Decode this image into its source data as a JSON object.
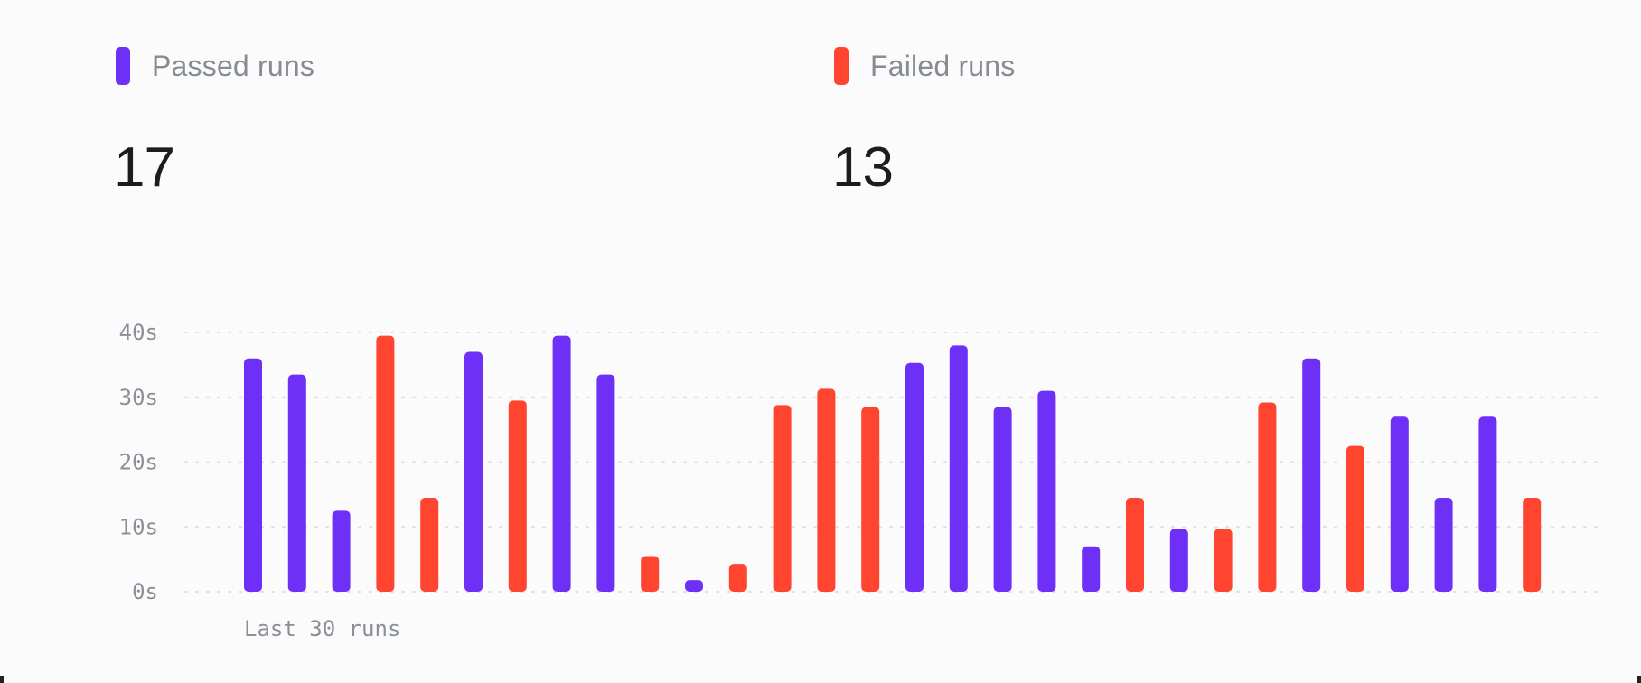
{
  "colors": {
    "passed": "#6e2ff7",
    "failed": "#ff4530",
    "grid": "#dedfe3",
    "background": "#fbfbfc"
  },
  "stats": {
    "passed": {
      "label": "Passed runs",
      "value": "17"
    },
    "failed": {
      "label": "Failed runs",
      "value": "13"
    }
  },
  "chart_data": {
    "type": "bar",
    "xlabel": "Last 30 runs",
    "ylabel": "",
    "ylim": [
      0,
      40
    ],
    "yticks": [
      {
        "value": 40,
        "label": "40s"
      },
      {
        "value": 30,
        "label": "30s"
      },
      {
        "value": 20,
        "label": "20s"
      },
      {
        "value": 10,
        "label": "10s"
      },
      {
        "value": 0,
        "label": "0s"
      }
    ],
    "grid": true,
    "legend": "top",
    "bars": [
      {
        "value": 36,
        "status": "passed"
      },
      {
        "value": 33.5,
        "status": "passed"
      },
      {
        "value": 12.5,
        "status": "passed"
      },
      {
        "value": 39.5,
        "status": "failed"
      },
      {
        "value": 14.5,
        "status": "failed"
      },
      {
        "value": 37,
        "status": "passed"
      },
      {
        "value": 29.5,
        "status": "failed"
      },
      {
        "value": 39.5,
        "status": "passed"
      },
      {
        "value": 33.5,
        "status": "passed"
      },
      {
        "value": 5.5,
        "status": "failed"
      },
      {
        "value": 1.8,
        "status": "passed"
      },
      {
        "value": 4.3,
        "status": "failed"
      },
      {
        "value": 28.8,
        "status": "failed"
      },
      {
        "value": 31.3,
        "status": "failed"
      },
      {
        "value": 28.5,
        "status": "failed"
      },
      {
        "value": 35.3,
        "status": "passed"
      },
      {
        "value": 38,
        "status": "passed"
      },
      {
        "value": 28.5,
        "status": "passed"
      },
      {
        "value": 31,
        "status": "passed"
      },
      {
        "value": 7,
        "status": "passed"
      },
      {
        "value": 14.5,
        "status": "failed"
      },
      {
        "value": 9.7,
        "status": "passed"
      },
      {
        "value": 9.7,
        "status": "failed"
      },
      {
        "value": 29.2,
        "status": "failed"
      },
      {
        "value": 36,
        "status": "passed"
      },
      {
        "value": 22.5,
        "status": "failed"
      },
      {
        "value": 27,
        "status": "passed"
      },
      {
        "value": 14.5,
        "status": "passed"
      },
      {
        "value": 27,
        "status": "passed"
      },
      {
        "value": 14.5,
        "status": "failed"
      }
    ]
  }
}
